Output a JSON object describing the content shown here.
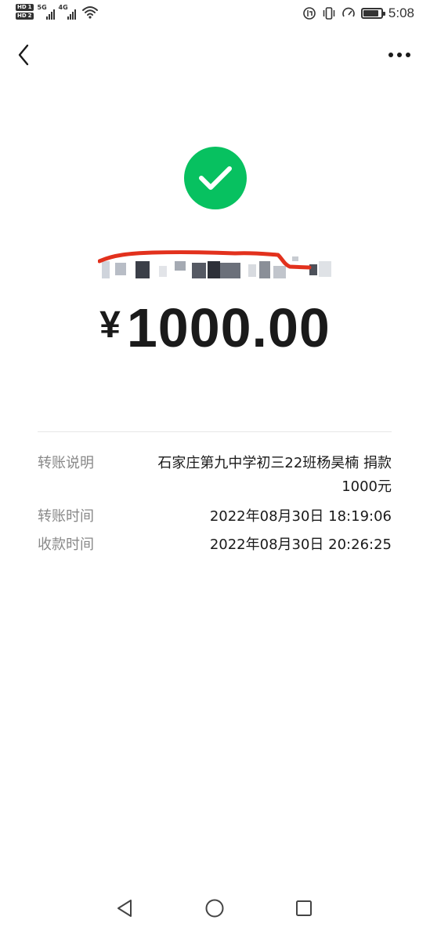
{
  "status_bar": {
    "sim_badges": [
      {
        "label": "HD",
        "slot": "1"
      },
      {
        "label": "HD",
        "slot": "2"
      }
    ],
    "signals": [
      {
        "generation": "5G"
      },
      {
        "generation": "4G"
      }
    ],
    "time": "5:08",
    "battery_level": 0.85,
    "icons": [
      "hd-icon",
      "signal-5g-icon",
      "signal-4g-icon",
      "wifi-icon",
      "data-saver-icon",
      "vibrate-icon",
      "speed-icon",
      "battery-icon"
    ]
  },
  "nav": {
    "back_icon": "chevron-left-icon",
    "more_icon": "more-dots-icon"
  },
  "status_icon": "check-circle-icon",
  "colors": {
    "success": "#07c160",
    "text_primary": "#1a1a1a",
    "text_secondary": "#888888",
    "redaction_mark": "#e2311d"
  },
  "amount": {
    "currency": "¥",
    "value": "1000.00"
  },
  "details": [
    {
      "label": "转账说明",
      "value": "石家庄第九中学初三22班杨昊楠 捐款1000元"
    },
    {
      "label": "转账时间",
      "value": "2022年08月30日 18:19:06"
    },
    {
      "label": "收款时间",
      "value": "2022年08月30日 20:26:25"
    }
  ],
  "system_nav": [
    "triangle-back-icon",
    "circle-home-icon",
    "square-recents-icon"
  ]
}
